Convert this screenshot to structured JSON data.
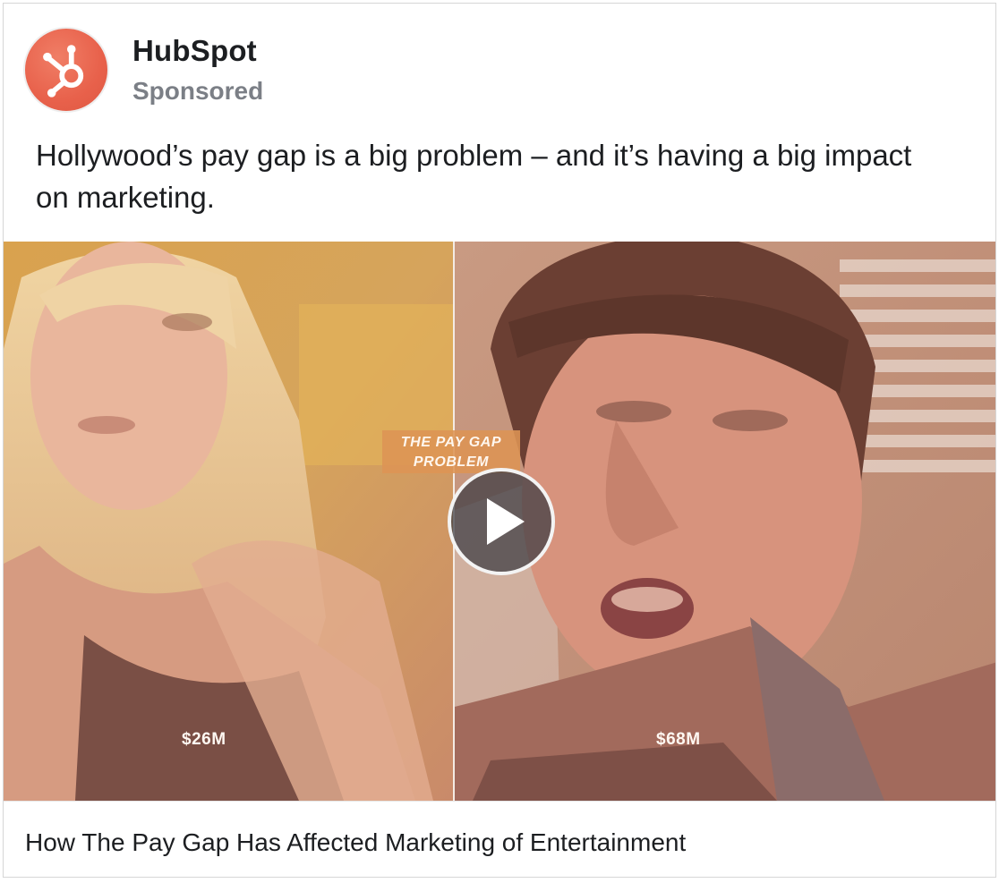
{
  "advertiser": {
    "name": "HubSpot",
    "label": "Sponsored",
    "logo_icon": "hubspot-sprocket-icon",
    "brand_color": "#e8614b"
  },
  "post": {
    "text": "Hollywood’s pay gap is a big problem – and it’s having a big impact on marketing."
  },
  "video": {
    "overlay_title": "THE PAY GAP PROBLEM",
    "left_amount": "$26M",
    "right_amount": "$68M",
    "play_icon": "play-icon"
  },
  "link": {
    "title": "How The Pay Gap Has Affected Marketing of Entertainment"
  }
}
